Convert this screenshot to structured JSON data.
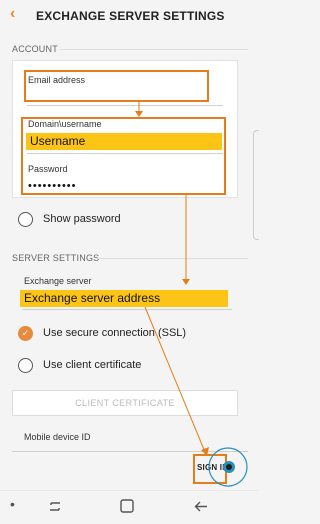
{
  "header": {
    "title": "EXCHANGE SERVER SETTINGS",
    "back_icon": "back-arrow-icon"
  },
  "account": {
    "section_label": "ACCOUNT",
    "email": {
      "label": "Email address",
      "value": ""
    },
    "username": {
      "label": "Domain\\username",
      "value": "Username"
    },
    "password": {
      "label": "Password",
      "value": "••••••••••"
    },
    "show_password_label": "Show password"
  },
  "server": {
    "section_label": "SERVER SETTINGS",
    "exchange_server": {
      "label": "Exchange server",
      "value": "Exchange server address"
    },
    "secure_connection_label": "Use secure connection (SSL)",
    "secure_connection_checked": true,
    "client_cert_label": "Use client certificate",
    "client_cert_checked": false,
    "client_cert_button": "CLIENT CERTIFICATE",
    "mobile_device_id_label": "Mobile device ID"
  },
  "footer": {
    "sign_in_label": "SIGN IN"
  },
  "colors": {
    "accent": "#e8893d",
    "highlight": "#fcc516",
    "annotation": "#e57e1a",
    "ring": "#2a8fb8"
  }
}
